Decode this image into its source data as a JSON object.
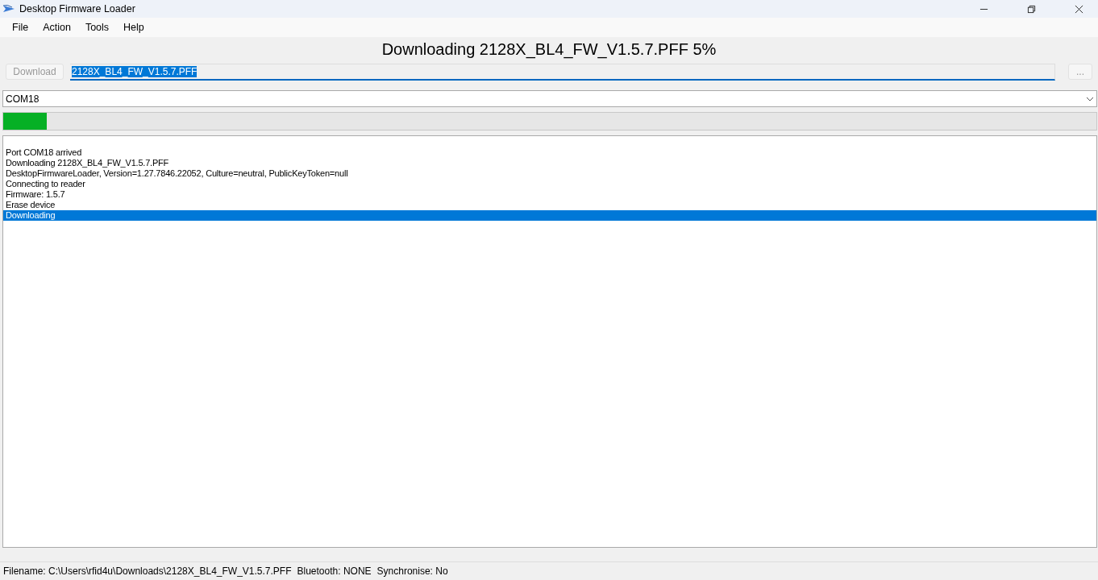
{
  "window": {
    "title": "Desktop Firmware Loader"
  },
  "menu": [
    "File",
    "Action",
    "Tools",
    "Help"
  ],
  "heading": "Downloading 2128X_BL4_FW_V1.5.7.PFF 5%",
  "download_button": {
    "label": "Download",
    "disabled": true
  },
  "file_field": {
    "value": "2128X_BL4_FW_V1.5.7.PFF",
    "selected": true
  },
  "browse_button": {
    "label": "...",
    "disabled": true
  },
  "port_select": {
    "value": "COM18"
  },
  "progress": {
    "level": 0.04
  },
  "log": [
    {
      "text": "Port COM18 arrived",
      "selected": false
    },
    {
      "text": "Downloading 2128X_BL4_FW_V1.5.7.PFF",
      "selected": false
    },
    {
      "text": "DesktopFirmwareLoader, Version=1.27.7846.22052, Culture=neutral, PublicKeyToken=null",
      "selected": false
    },
    {
      "text": "Connecting to reader",
      "selected": false
    },
    {
      "text": "Firmware: 1.5.7",
      "selected": false
    },
    {
      "text": "Erase device",
      "selected": false
    },
    {
      "text": "Downloading",
      "selected": true
    }
  ],
  "status_bar": [
    "Filename: C:\\Users\\rfid4u\\Downloads\\2128X_BL4_FW_V1.5.7.PFF",
    "Bluetooth: NONE",
    "Synchronise: No"
  ]
}
